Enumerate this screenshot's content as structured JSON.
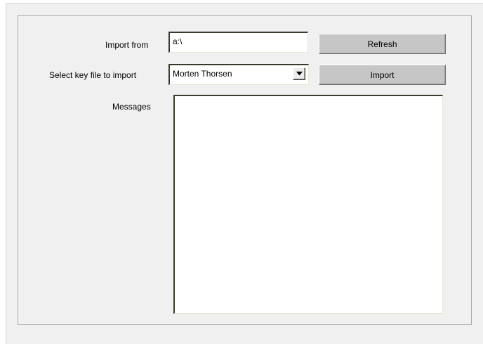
{
  "form": {
    "import_from_label": "Import from",
    "import_from_value": "a:\\",
    "select_key_label": "Select key file to import",
    "select_key_value": "Morten Thorsen",
    "messages_label": "Messages",
    "messages_text": ""
  },
  "buttons": {
    "refresh_label": "Refresh",
    "import_label": "Import"
  },
  "icons": {
    "dropdown": "chevron-down-icon"
  },
  "colors": {
    "window_background": "#f0f0f0",
    "button_face": "#c6c6c6",
    "field_background": "#ffffff",
    "panel_border": "#a9a9a9"
  }
}
